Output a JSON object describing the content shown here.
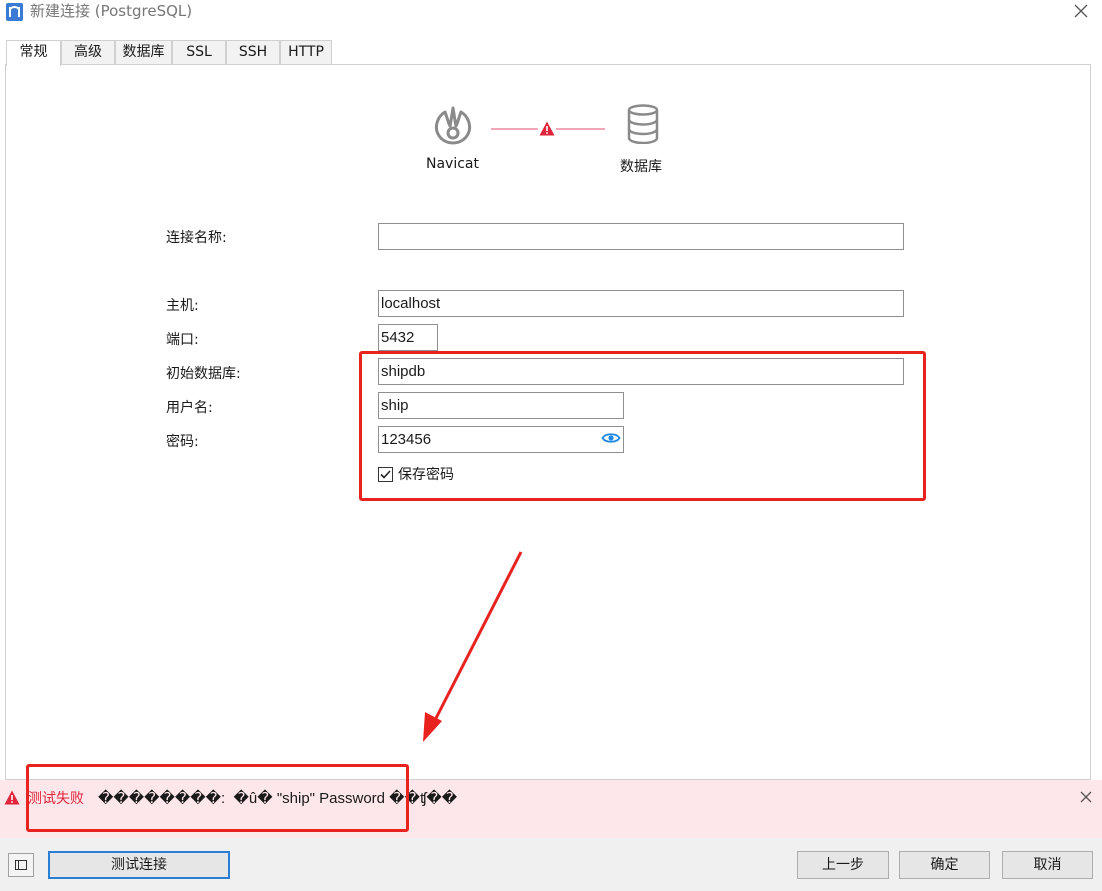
{
  "window": {
    "title": "新建连接 (PostgreSQL)"
  },
  "tabs": [
    {
      "label": "常规"
    },
    {
      "label": "高级"
    },
    {
      "label": "数据库"
    },
    {
      "label": "SSL"
    },
    {
      "label": "SSH"
    },
    {
      "label": "HTTP"
    }
  ],
  "diagram": {
    "source_label": "Navicat",
    "target_label": "数据库",
    "status_icon": "warning-icon"
  },
  "form": {
    "connection_name_label": "连接名称:",
    "connection_name_value": "",
    "host_label": "主机:",
    "host_value": "localhost",
    "port_label": "端口:",
    "port_value": "5432",
    "initial_db_label": "初始数据库:",
    "initial_db_value": "shipdb",
    "username_label": "用户名:",
    "username_value": "ship",
    "password_label": "密码:",
    "password_value": "123456",
    "save_password_label": "保存密码",
    "save_password_checked": true
  },
  "error": {
    "title": "测试失败",
    "message": "��������:  �û� \"ship\" Password ��ʧ��"
  },
  "buttons": {
    "test_connection": "测试连接",
    "previous": "上一步",
    "ok": "确定",
    "cancel": "取消"
  },
  "colors": {
    "annotation_red": "#e8231f",
    "error_text": "#e0243b",
    "error_background": "#fde7ea",
    "link_line": "#f2a7b8",
    "primary_border": "#2a7fd4"
  }
}
